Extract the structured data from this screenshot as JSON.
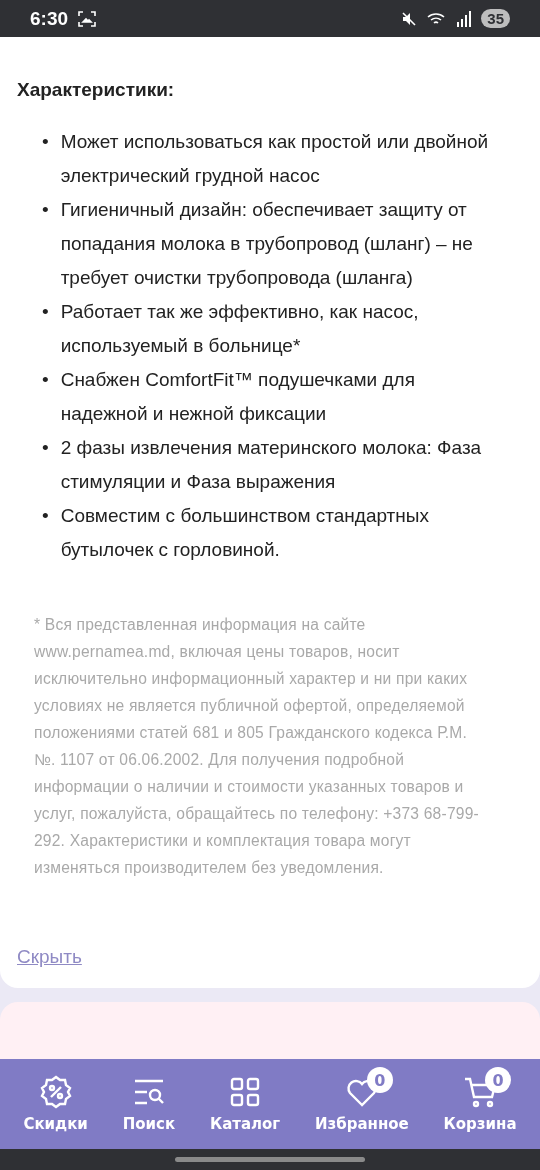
{
  "status_bar": {
    "time": "6:30",
    "battery": "35"
  },
  "section": {
    "heading": "Характеристики:",
    "bullets": [
      {
        "marker": "•",
        "text": "Может использоваться как простой или двойной электрический грудной насос"
      },
      {
        "marker": "•",
        "text": "Гигиеничный дизайн: обеспечивает защиту от попадания молока в трубопровод (шланг) – не требует очистки трубопровода (шланга)"
      },
      {
        "marker": "•",
        "text": "Работает так же эффективно, как насос, используемый в больнице*"
      },
      {
        "marker": "•",
        "text": "Снабжен ComfortFit™ подушечками для надежной и нежной фиксации"
      },
      {
        "marker": "•",
        "text": "2 фазы извлечения материнского молока: Фаза стимуляции и Фаза выражения"
      },
      {
        "marker": "•",
        "text": "Совместим с большинством стандартных бутылочек с горловиной."
      }
    ],
    "disclaimer": "* Вся представленная информация на сайте www.pernamea.md, включая цены товаров, носит исключительно информационный характер и ни при каких условиях не является публичной офертой, определяемой положениями статей 681 и 805 Гражданского кодекса Р.М. №. 1107 от 06.06.2002. Для получения подробной информации о наличии и стоимости указанных товаров и услуг, пожалуйста, обращайтесь по телефону: +373 68-799-292. Характеристики и комплектация товара могут изменяться производителем без уведомления.",
    "hide_link": "Скрыть"
  },
  "bottom_nav": [
    {
      "kind": "discount",
      "label": "Скидки"
    },
    {
      "kind": "search",
      "label": "Поиск"
    },
    {
      "kind": "catalog",
      "label": "Каталог"
    },
    {
      "kind": "favorites",
      "label": "Избранное",
      "badge": "0"
    },
    {
      "kind": "cart",
      "label": "Корзина",
      "badge": "0"
    }
  ]
}
